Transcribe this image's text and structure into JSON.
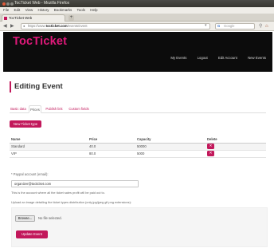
{
  "window": {
    "title": "TocTicket Web - Mozilla Firefox"
  },
  "menu": [
    "File",
    "Edit",
    "View",
    "History",
    "Bookmarks",
    "Tools",
    "Help"
  ],
  "browser_tab": {
    "label": "TocTicket Web"
  },
  "address_bar": {
    "url_prefix": "https://www.",
    "url_domain": "tocticket.com",
    "url_path": "/events/event",
    "search_placeholder": "Google"
  },
  "site": {
    "logo": "TocTicket",
    "nav": [
      "My Events",
      "Logout",
      "Edit Account",
      "New Events"
    ]
  },
  "page": {
    "title": "Editing Event",
    "tabs": [
      {
        "label": "Basic data",
        "active": false
      },
      {
        "label": "Prices",
        "active": true
      },
      {
        "label": "Publish link",
        "active": false
      },
      {
        "label": "Custom fields",
        "active": false
      }
    ],
    "new_ticket_button": "New Ticket type",
    "table": {
      "headers": [
        "Name",
        "Price",
        "Capacity",
        "Delete"
      ],
      "rows": [
        {
          "name": "Standard",
          "price": "40.0",
          "capacity": "50000"
        },
        {
          "name": "VIP",
          "price": "80.0",
          "capacity": "5000"
        }
      ]
    },
    "paypal": {
      "label": "* Paypal account (email):",
      "value": "organizer@tocticket.com",
      "help": "This is the account where all the ticket sales profit will be paid out to."
    },
    "upload": {
      "label": "Upload an image detailing the ticket types distribution (only jpg/jpeg gif png extensions):",
      "browse_label": "Browse...",
      "no_file": "No file selected.",
      "submit_label": "Update Event"
    }
  },
  "colors": {
    "accent": "#c2185b",
    "header_bg": "#0c0c0c"
  }
}
